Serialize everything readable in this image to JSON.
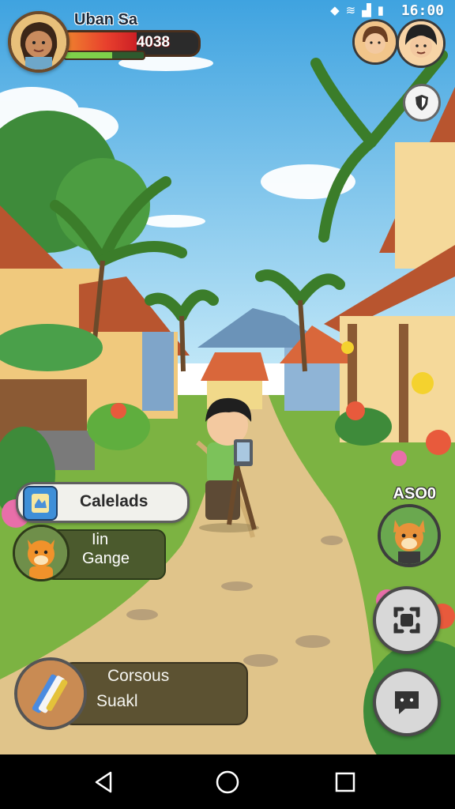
{
  "status_bar": {
    "time": "16:00"
  },
  "player": {
    "name": "Uban Sa",
    "hp_value": "4038",
    "hp_fill_fraction": 0.55,
    "xp_fill_fraction": 0.6
  },
  "quest_button": {
    "label": "Calelads"
  },
  "pet_panel": {
    "line1": "Iin",
    "line2": "Gange"
  },
  "item_panel": {
    "line1": "Corsous",
    "line2": "Suakl"
  },
  "companion": {
    "label": "ASO0"
  },
  "icons": {
    "shield": "shield-icon",
    "expand": "expand-icon",
    "chat": "chat-icon",
    "back": "back-icon",
    "home": "home-icon",
    "recent": "recent-apps-icon",
    "wifi": "wifi-icon",
    "signal": "signal-icon",
    "battery": "battery-icon"
  },
  "colors": {
    "hp": "#e8402d",
    "xp": "#7ed04b",
    "sky": "#58b4e8",
    "path": "#e0c48a",
    "grass": "#7cb342"
  }
}
